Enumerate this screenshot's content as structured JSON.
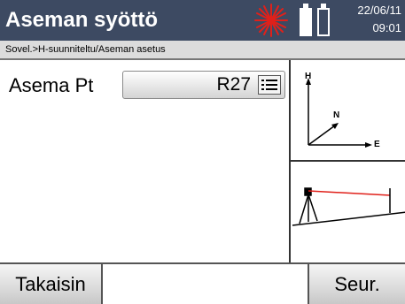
{
  "header": {
    "title": "Aseman syöttö",
    "date": "22/06/11",
    "time": "09:01",
    "laser_icon": "laser-star-icon",
    "laser_color": "#e0201a",
    "battery_icons": [
      "battery-full-icon",
      "battery-empty-icon"
    ]
  },
  "breadcrumb": "Sovel.>H-suunniteltu/Aseman asetus",
  "form": {
    "station_label": "Asema Pt",
    "station_value": "R27",
    "list_icon": "list-icon"
  },
  "diagram": {
    "axes": {
      "h_label": "H",
      "n_label": "N",
      "e_label": "E"
    },
    "instrument_icon": "tripod-instrument-icon",
    "measure_line_color": "#e0201a"
  },
  "footer": {
    "back_label": "Takaisin",
    "next_label": "Seur."
  },
  "colors": {
    "title_bar": "#3d4a62",
    "breadcrumb_bg": "#dcdcdc"
  }
}
